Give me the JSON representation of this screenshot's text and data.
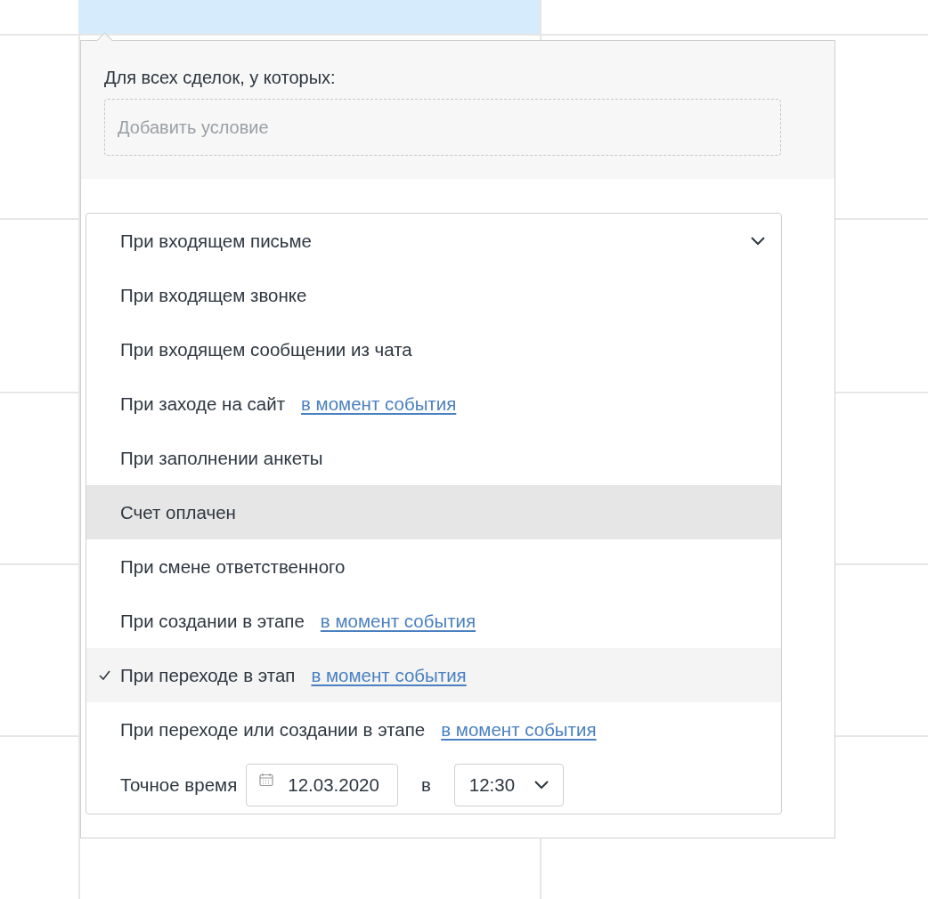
{
  "filter": {
    "label": "Для всех сделок, у которых:",
    "placeholder": "Добавить условие"
  },
  "triggers": [
    {
      "kind": "option",
      "label": "При входящем письме",
      "selected": false,
      "hovered": false
    },
    {
      "kind": "option",
      "label": "При входящем звонке",
      "selected": false,
      "hovered": false
    },
    {
      "kind": "option",
      "label": "При входящем сообщении из чата",
      "selected": false,
      "hovered": false
    },
    {
      "kind": "option",
      "label": "При заходе на сайт",
      "link": "в момент события",
      "selected": false,
      "hovered": false
    },
    {
      "kind": "option",
      "label": "При заполнении анкеты",
      "selected": false,
      "hovered": false
    },
    {
      "kind": "option",
      "label": "Счет оплачен",
      "selected": false,
      "hovered": true
    },
    {
      "kind": "option",
      "label": "При смене ответственного",
      "selected": false,
      "hovered": false
    },
    {
      "kind": "option",
      "label": "При создании в этапе",
      "link": "в момент события",
      "selected": false,
      "hovered": false
    },
    {
      "kind": "option",
      "label": "При переходе в этап",
      "link": "в момент события",
      "selected": true,
      "hovered": false
    },
    {
      "kind": "option",
      "label": "При переходе или создании в этапе",
      "link": "в момент события",
      "selected": false,
      "hovered": false
    },
    {
      "kind": "time",
      "label": "Точное время",
      "date": "12.03.2020",
      "separator": "в",
      "time": "12:30",
      "selected": false,
      "hovered": false
    }
  ]
}
